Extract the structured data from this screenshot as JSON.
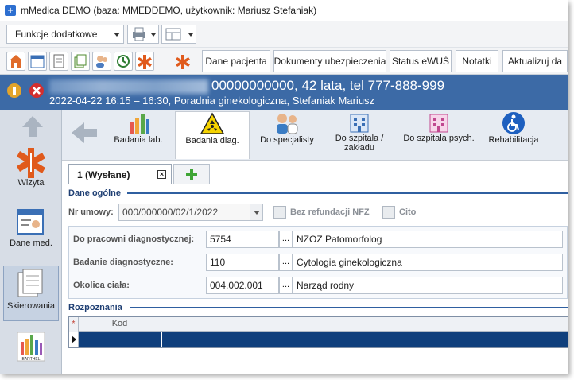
{
  "window": {
    "title": "mMedica DEMO (baza: MMEDDEMO, użytkownik: Mariusz Stefaniak)"
  },
  "toolbar": {
    "functions_combo": "Funkcje dodatkowe",
    "buttons": [
      {
        "label": "Dane pacjenta"
      },
      {
        "label": "Dokumenty ubezpieczenia"
      },
      {
        "label": "Status eWUŚ"
      },
      {
        "label": "Notatki"
      },
      {
        "label": "Aktualizuj da"
      }
    ]
  },
  "patient": {
    "id_line": "00000000000, 42 lata, tel 777-888-999",
    "visit_line": "2022-04-22 16:15 – 16:30, Poradnia ginekologiczna, Stefaniak Mariusz"
  },
  "sidebar": {
    "items": [
      {
        "label": "Wizyta",
        "icon": "medical-star-icon"
      },
      {
        "label": "Dane med.",
        "icon": "patient-card-icon"
      },
      {
        "label": "Skierowania",
        "icon": "documents-icon"
      },
      {
        "label": "",
        "icon": "barthel-icon",
        "logo_text": "BARTHEL"
      }
    ]
  },
  "modules": [
    {
      "label": "Badania lab.",
      "icon": "lab-chart-icon"
    },
    {
      "label": "Badania diag.",
      "icon": "radiation-icon"
    },
    {
      "label": "Do specjalisty",
      "icon": "doctors-icon"
    },
    {
      "label": "Do szpitala / zakładu",
      "icon": "hospital-icon"
    },
    {
      "label": "Do szpitala psych.",
      "icon": "hospital-pink-icon"
    },
    {
      "label": "Rehabilitacja",
      "icon": "wheelchair-icon"
    }
  ],
  "tabs": {
    "active": "1 (Wysłane)",
    "close": "×"
  },
  "general": {
    "section": "Dane ogólne",
    "contract_label": "Nr umowy:",
    "contract_value": "000/000000/02/1/2022",
    "no_refund_label": "Bez refundacji NFZ",
    "cito_label": "Cito",
    "lab_label": "Do pracowni diagnostycznej:",
    "lab_code": "5754",
    "lab_name": "NZOZ Patomorfolog",
    "exam_label": "Badanie diagnostyczne:",
    "exam_code": "110",
    "exam_name": "Cytologia ginekologiczna",
    "area_label": "Okolica ciała:",
    "area_code": "004.002.001",
    "area_name": "Narząd rodny",
    "dots": "..."
  },
  "diagnosis": {
    "section": "Rozpoznania",
    "col_code": "Kod",
    "star": "*"
  },
  "colors": {
    "header_blue": "#3c6aa6",
    "row_selected": "#0f3f7c",
    "section_blue": "#1f3f73"
  }
}
